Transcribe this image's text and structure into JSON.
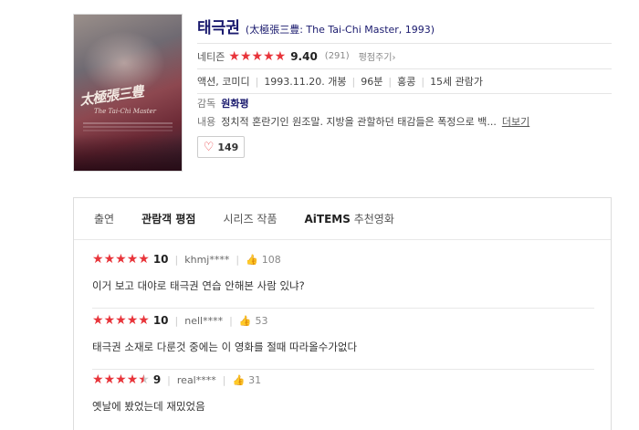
{
  "movie": {
    "title": "태극권",
    "subtitle": "(太極張三豊: The Tai-Chi Master, 1993)",
    "netizen_label": "네티즌",
    "score": "9.40",
    "vote_count": "(291)",
    "rate_link": "평점주기",
    "genre": "액션, 코미디",
    "release": "1993.11.20. 개봉",
    "runtime": "96분",
    "country": "홍콩",
    "grade": "15세 관람가",
    "director_label": "감독",
    "director": "원화평",
    "synopsis_label": "내용",
    "synopsis": "정치적 혼란기인 원조말. 지방을 관할하던 태감들은 폭정으로 백...",
    "more_link": "더보기",
    "likes": "149"
  },
  "poster": {
    "calligraphy": "太極張三豊",
    "english": "The Tai-Chi Master"
  },
  "tabs": [
    {
      "label": "출연"
    },
    {
      "label": "관람객 평점"
    },
    {
      "label": "시리즈 작품"
    },
    {
      "label": "AiTEMS",
      "suffix": "추천영화"
    }
  ],
  "reviews": [
    {
      "score": "10",
      "user": "khmj****",
      "likes": "108",
      "text": "이거 보고 대야로 태극권 연습 안해본 사람 있냐?"
    },
    {
      "score": "10",
      "user": "nell****",
      "likes": "53",
      "text": "태극권 소재로 다룬것 중에는 이 영화를 절때 따라올수가없다"
    },
    {
      "score": "9",
      "user": "real****",
      "likes": "31",
      "text": "옛날에 봤었는데 재밌었음"
    }
  ],
  "colors": {
    "star": "#e8343a",
    "title": "#1a1a6e",
    "thumb": "#f0a030"
  },
  "icons": {
    "heart": "heart-icon",
    "thumb": "thumbs-up-icon",
    "star": "star-icon"
  }
}
